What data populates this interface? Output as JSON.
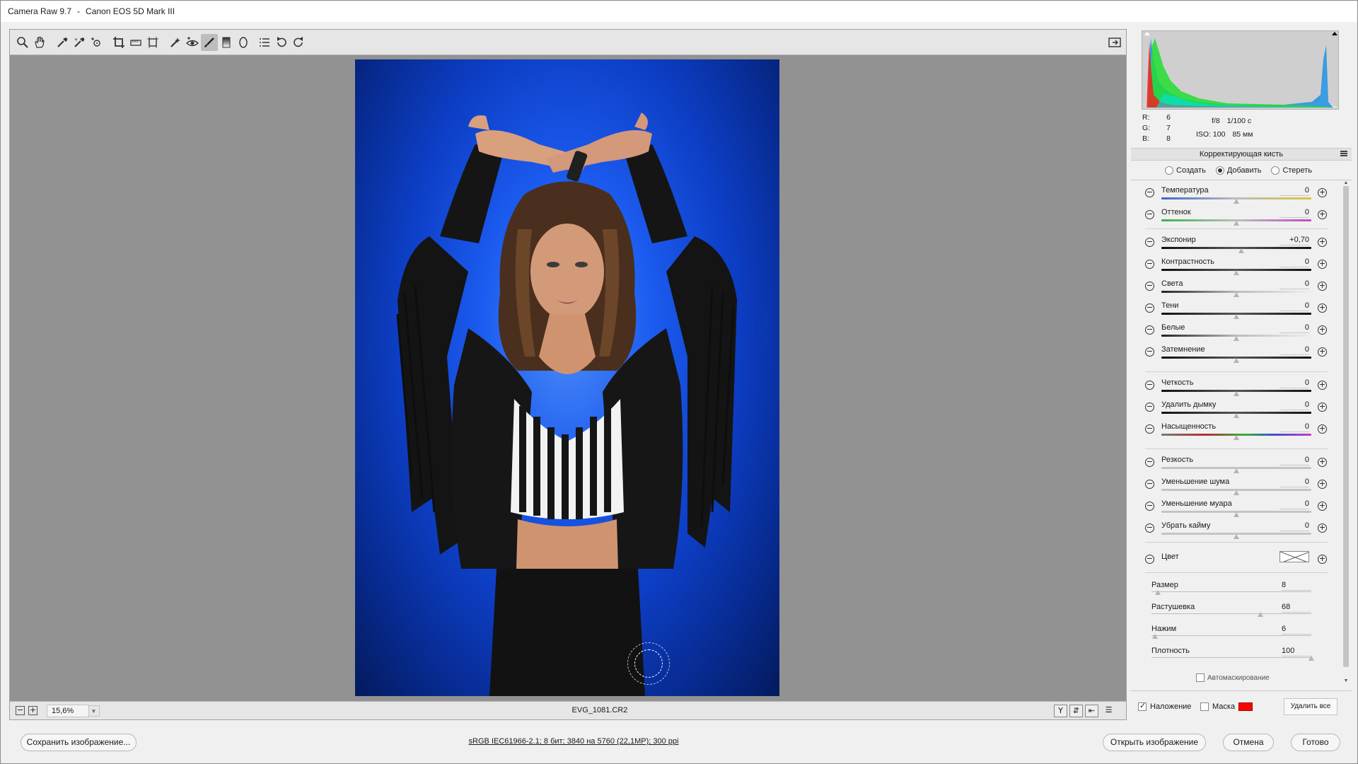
{
  "window": {
    "app_title": "Camera Raw 9.7",
    "separator": "-",
    "camera": "Canon EOS 5D Mark III"
  },
  "toolbar": {
    "tools": [
      {
        "name": "zoom-tool",
        "icon": "magnifier-icon"
      },
      {
        "name": "hand-tool",
        "icon": "hand-icon"
      },
      {
        "name": "white-balance-tool",
        "icon": "eyedropper-icon"
      },
      {
        "name": "color-sampler-tool",
        "icon": "color-sampler-icon"
      },
      {
        "name": "targeted-adjustment-tool",
        "icon": "target-adjust-icon"
      },
      {
        "name": "crop-tool",
        "icon": "crop-icon"
      },
      {
        "name": "straighten-tool",
        "icon": "level-icon"
      },
      {
        "name": "transform-tool",
        "icon": "transform-icon"
      },
      {
        "name": "spot-removal-tool",
        "icon": "spot-removal-icon"
      },
      {
        "name": "red-eye-tool",
        "icon": "eye-icon"
      },
      {
        "name": "adjustment-brush-tool",
        "icon": "brush-icon",
        "active": true
      },
      {
        "name": "graduated-filter-tool",
        "icon": "graduated-filter-icon"
      },
      {
        "name": "radial-filter-tool",
        "icon": "radial-filter-icon"
      },
      {
        "name": "preferences-tool",
        "icon": "list-icon"
      },
      {
        "name": "rotate-ccw-tool",
        "icon": "rotate-left-icon"
      },
      {
        "name": "rotate-cw-tool",
        "icon": "rotate-right-icon"
      }
    ],
    "fullscreen_icon": "fullscreen-icon"
  },
  "status": {
    "zoom": "15,6%",
    "filename": "EVG_1081.CR2"
  },
  "histogram": {
    "r_label": "R:",
    "r": "6",
    "g_label": "G:",
    "g": "7",
    "b_label": "B:",
    "b": "8",
    "aperture": "f/8",
    "shutter": "1/100 с",
    "iso": "ISO: 100",
    "focal": "85 мм"
  },
  "panel": {
    "title": "Корректирующая кисть",
    "modes": [
      {
        "label": "Создать",
        "selected": false
      },
      {
        "label": "Добавить",
        "selected": true
      },
      {
        "label": "Стереть",
        "selected": false
      }
    ],
    "adjustments": [
      {
        "label": "Температура",
        "value": "0",
        "position": 0.5,
        "track": "temp"
      },
      {
        "label": "Оттенок",
        "value": "0",
        "position": 0.5,
        "track": "tint"
      },
      {
        "label": "Экспонир",
        "value": "+0,70",
        "position": 0.535,
        "track": "dark"
      },
      {
        "label": "Контрастность",
        "value": "0",
        "position": 0.5,
        "track": "dark"
      },
      {
        "label": "Света",
        "value": "0",
        "position": 0.5,
        "track": "light"
      },
      {
        "label": "Тени",
        "value": "0",
        "position": 0.5,
        "track": "dark"
      },
      {
        "label": "Белые",
        "value": "0",
        "position": 0.5,
        "track": "light"
      },
      {
        "label": "Затемнение",
        "value": "0",
        "position": 0.5,
        "track": "dark"
      },
      {
        "label": "Четкость",
        "value": "0",
        "position": 0.5,
        "track": "dark"
      },
      {
        "label": "Удалить дымку",
        "value": "0",
        "position": 0.5,
        "track": "dark"
      },
      {
        "label": "Насыщенность",
        "value": "0",
        "position": 0.5,
        "track": "sat"
      },
      {
        "label": "Резкость",
        "value": "0",
        "position": 0.5,
        "track": "plain"
      },
      {
        "label": "Уменьшение шума",
        "value": "0",
        "position": 0.5,
        "track": "plain"
      },
      {
        "label": "Уменьшение муара",
        "value": "0",
        "position": 0.5,
        "track": "plain"
      },
      {
        "label": "Убрать кайму",
        "value": "0",
        "position": 0.5,
        "track": "plain"
      }
    ],
    "color_label": "Цвет",
    "brush": [
      {
        "label": "Размер",
        "value": "8",
        "position": 0.04
      },
      {
        "label": "Растушевка",
        "value": "68",
        "position": 0.68
      },
      {
        "label": "Нажим",
        "value": "6",
        "position": 0.02
      },
      {
        "label": "Плотность",
        "value": "100",
        "position": 1.0
      }
    ],
    "auto_mask_label": "Автомаскирование",
    "overlay_label": "Наложение",
    "overlay_checked": true,
    "mask_label": "Маска",
    "mask_checked": false,
    "mask_color": "#ff0000",
    "clear_all": "Удалить все"
  },
  "footer": {
    "save_button": "Сохранить изображение...",
    "workflow": "sRGB IEC61966-2.1; 8 бит; 3840 на 5760 (22,1МР); 300 ppi",
    "open_button": "Открыть изображение",
    "cancel_button": "Отмена",
    "done_button": "Готово"
  }
}
